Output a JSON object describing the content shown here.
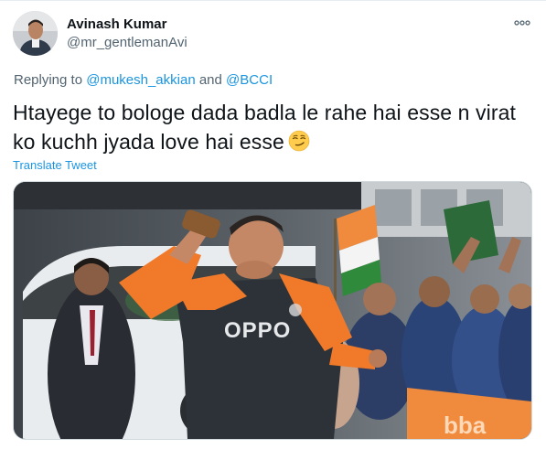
{
  "author": {
    "display_name": "Avinash Kumar",
    "handle": "@mr_gentlemanAvi"
  },
  "reply": {
    "prefix": "Replying to",
    "mention_1": "@mukesh_akkian",
    "joiner": "and",
    "mention_2": "@BCCI"
  },
  "tweet": {
    "line_1": "Htayege to bologe dada badla le rahe hai esse n virat",
    "line_2": "ko kuchh jyada love hai esse",
    "emoji": "smirking-face"
  },
  "translate_label": "Translate Tweet",
  "media": {
    "jersey_text": "OPPO",
    "banner_text": "bba"
  },
  "colors": {
    "link": "#1b95e0",
    "secondary_text": "#536471",
    "jersey_orange": "#f07a2a",
    "jersey_dark": "#2c3238"
  }
}
